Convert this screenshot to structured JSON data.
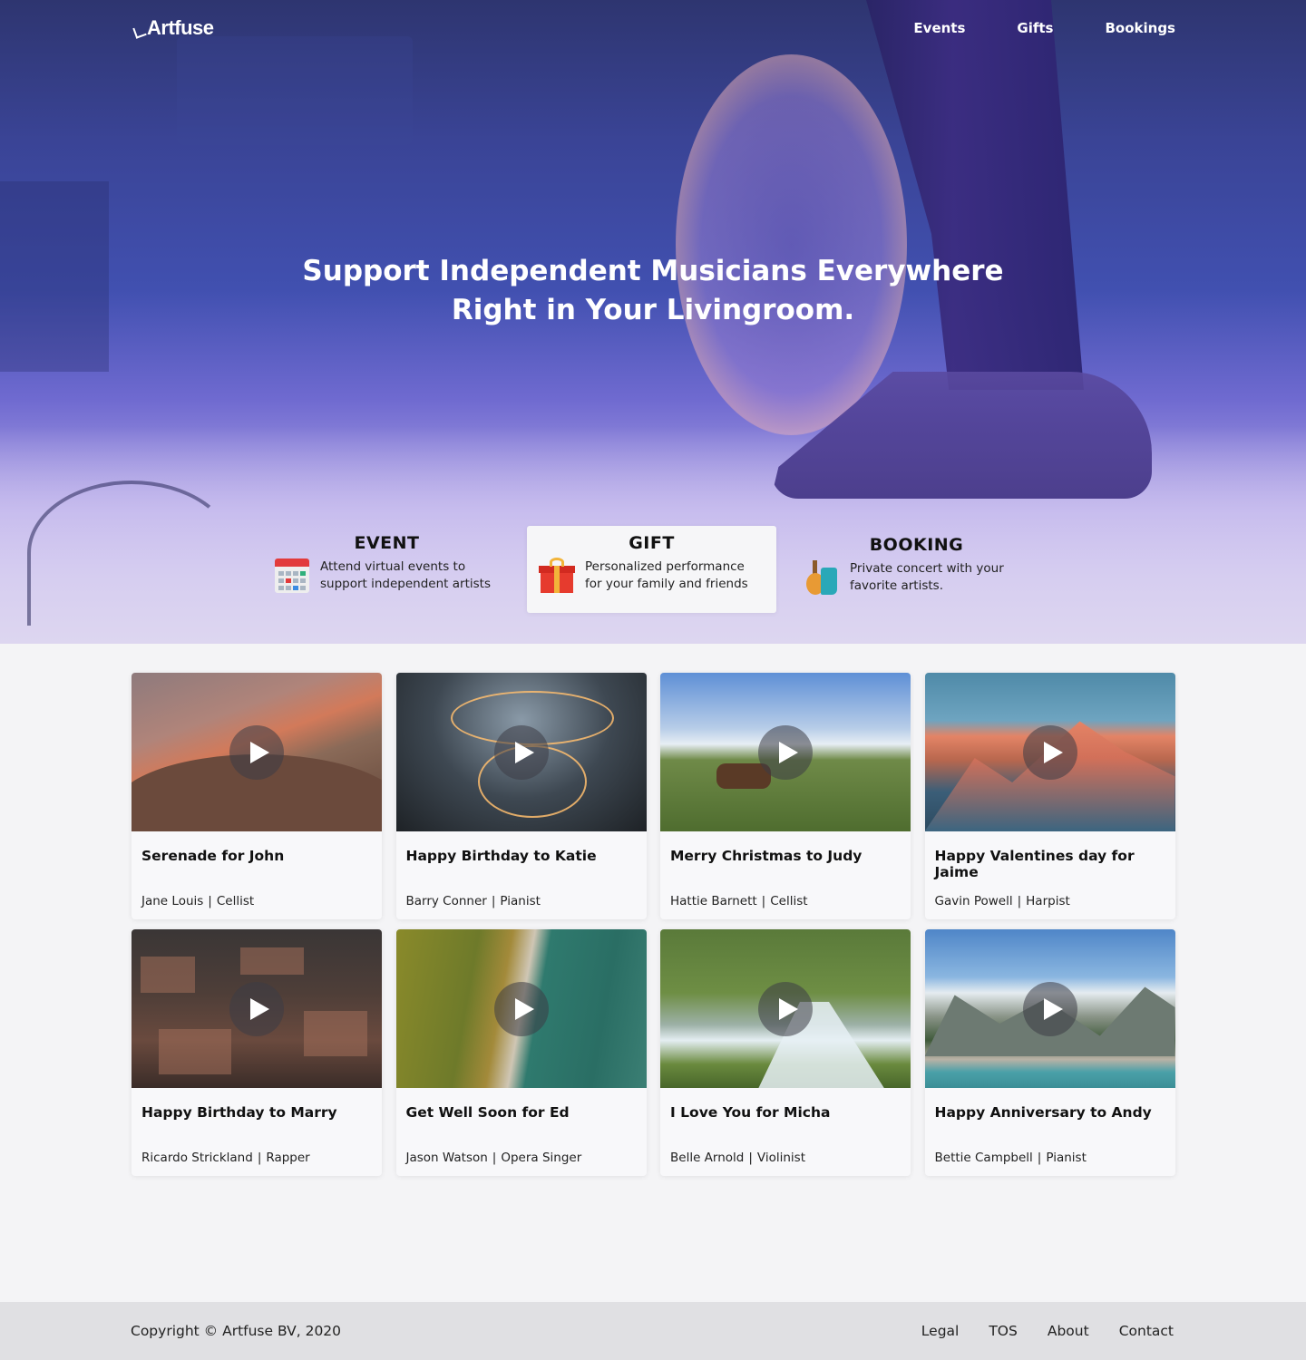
{
  "brand": {
    "logo_text": "Artfuse"
  },
  "nav": {
    "items": [
      "Events",
      "Gifts",
      "Bookings"
    ]
  },
  "hero": {
    "title_line1": "Support Independent Musicians Everywhere",
    "title_line2": "Right in Your Livingroom."
  },
  "features": [
    {
      "title": "EVENT",
      "desc": "Attend virtual events to support independent artists",
      "icon": "calendar-icon",
      "active": false
    },
    {
      "title": "GIFT",
      "desc": "Personalized performance for your family and friends",
      "icon": "gift-icon",
      "active": true
    },
    {
      "title": "BOOKING",
      "desc": "Private concert with your favorite artists.",
      "icon": "guitar-icon",
      "active": false
    }
  ],
  "cards": [
    {
      "title": "Serenade for John",
      "artist": "Jane Louis",
      "role": "Cellist"
    },
    {
      "title": "Happy Birthday to Katie",
      "artist": "Barry Conner",
      "role": "Pianist"
    },
    {
      "title": "Merry Christmas to Judy",
      "artist": "Hattie Barnett",
      "role": "Cellist"
    },
    {
      "title": "Happy Valentines day for Jaime",
      "artist": "Gavin Powell",
      "role": "Harpist"
    },
    {
      "title": "Happy Birthday to Marry",
      "artist": "Ricardo Strickland",
      "role": "Rapper"
    },
    {
      "title": "Get Well Soon for Ed",
      "artist": "Jason Watson",
      "role": "Opera Singer"
    },
    {
      "title": "I Love You for Micha",
      "artist": "Belle Arnold",
      "role": "Violinist"
    },
    {
      "title": "Happy Anniversary to Andy",
      "artist": "Bettie Campbell",
      "role": "Pianist"
    }
  ],
  "footer": {
    "copyright": "Copyright © Artfuse BV, 2020",
    "links": [
      "Legal",
      "TOS",
      "About",
      "Contact"
    ]
  }
}
